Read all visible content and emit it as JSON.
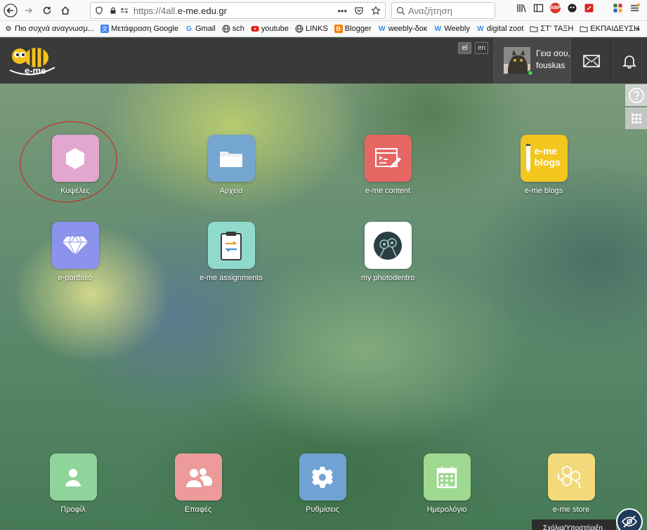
{
  "browser": {
    "url_prefix": "https://4all.",
    "url_domain": "e-me.edu.gr",
    "search_placeholder": "Αναζήτηση"
  },
  "bookmarks": [
    {
      "label": "Πιο συχνά αναγνωσμ...",
      "icon": "gear-icon"
    },
    {
      "label": "Μετάφραση Google",
      "icon": "google-translate-icon"
    },
    {
      "label": "Gmail",
      "icon": "google-icon"
    },
    {
      "label": "sch",
      "icon": "globe-icon"
    },
    {
      "label": "youtube",
      "icon": "youtube-icon"
    },
    {
      "label": "LINKS",
      "icon": "globe-icon"
    },
    {
      "label": "Blogger",
      "icon": "blogger-icon"
    },
    {
      "label": "weebly-δοκ",
      "icon": "weebly-icon"
    },
    {
      "label": "Weebly",
      "icon": "weebly-icon"
    },
    {
      "label": "digital zoot",
      "icon": "weebly-icon"
    },
    {
      "label": "ΣΤ' ΤΑΞΗ",
      "icon": "folder-icon"
    },
    {
      "label": "ΕΚΠΑΙΔΕΥΣΗ",
      "icon": "folder-icon"
    }
  ],
  "header": {
    "logo_text": "e-me",
    "lang_el": "el",
    "lang_en": "en",
    "greeting": "Γεια σου,",
    "username": "fouskas"
  },
  "apps": [
    {
      "label": "Κυψέλες",
      "color": "#e3a6cf",
      "icon": "hexagon-icon"
    },
    {
      "label": "Αρχεία",
      "color": "#74a6cf",
      "icon": "folder-icon"
    },
    {
      "label": "e-me content",
      "color": "#e66663",
      "icon": "content-editor-icon"
    },
    {
      "label": "e-me blogs",
      "color": "#f2c61d",
      "icon": "blogs-icon",
      "icon_text": "e-me blogs"
    },
    {
      "label": "e-portfolio",
      "color": "#8b93ec",
      "icon": "diamond-icon"
    },
    {
      "label": "e-me assignments",
      "color": "#8fdacd",
      "icon": "clipboard-icon"
    },
    {
      "label": "my photodentro",
      "color": "#ffffff",
      "icon": "photodentro-icon"
    }
  ],
  "dock": [
    {
      "label": "Προφίλ",
      "color": "#8fd49a",
      "icon": "user-icon"
    },
    {
      "label": "Επαφές",
      "color": "#ec9a9a",
      "icon": "contacts-icon"
    },
    {
      "label": "Ρυθμίσεις",
      "color": "#70a3d4",
      "icon": "settings-gear-icon"
    },
    {
      "label": "Ημερολόγιο",
      "color": "#9fd890",
      "icon": "calendar-icon"
    },
    {
      "label": "e-me store",
      "color": "#f2d97a",
      "icon": "honeycomb-icon"
    }
  ],
  "chat_label": "Σχόλια/Υποστήριξη"
}
